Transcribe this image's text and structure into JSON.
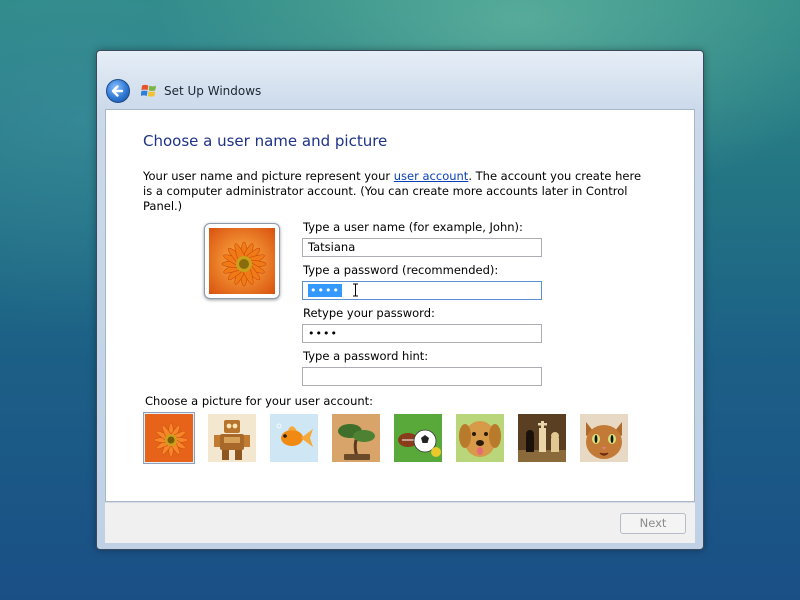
{
  "window": {
    "title": "Set Up Windows"
  },
  "page": {
    "heading": "Choose a user name and picture",
    "intro_before_link": "Your user name and picture represent your ",
    "intro_link": "user account",
    "intro_after_link": ". The account you create here is a computer administrator account. (You can create more accounts later in Control Panel.)"
  },
  "form": {
    "username_label": "Type a user name (for example, John):",
    "username_value": "Tatsiana",
    "password_label": "Type a password (recommended):",
    "password_value": "••••",
    "retype_label": "Retype your password:",
    "retype_value": "••••",
    "hint_label": "Type a password hint:",
    "hint_value": ""
  },
  "pictures": {
    "label": "Choose a picture for your user account:",
    "items": [
      "orange-flower",
      "robot",
      "goldfish",
      "bonsai",
      "sports-balls",
      "puppy",
      "chess",
      "kitten"
    ],
    "selected": "orange-flower"
  },
  "footer": {
    "next_label": "Next"
  }
}
